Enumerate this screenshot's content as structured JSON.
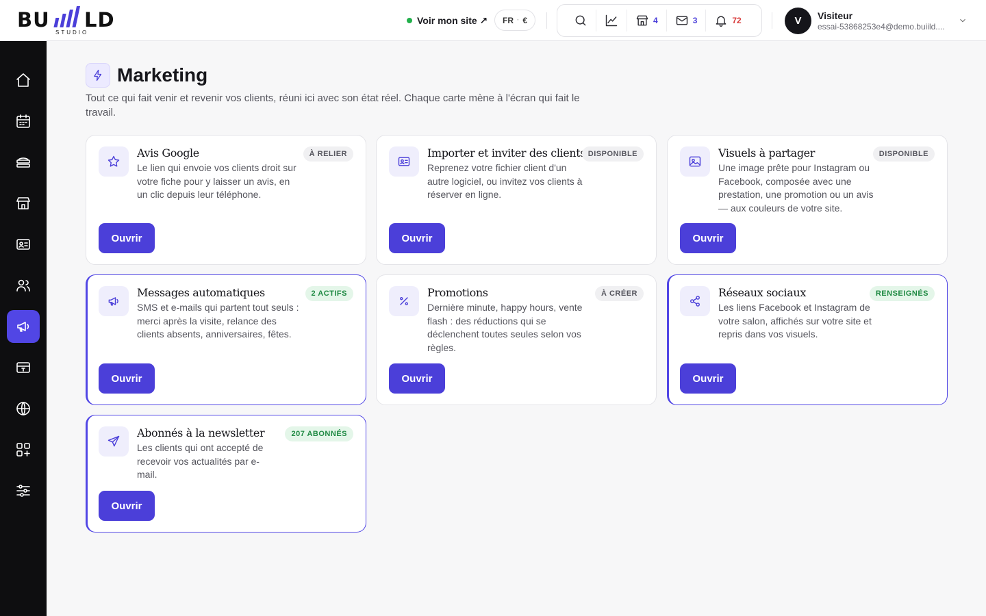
{
  "header": {
    "logo_text": "BU  LD",
    "logo_sub": "STUDIO",
    "site_link": "Voir mon site ↗",
    "lang": "FR",
    "lang_sep": "·",
    "currency": "€",
    "tools": {
      "shop_count": "4",
      "mail_count": "3",
      "notif_count": "72"
    },
    "user": {
      "initial": "V",
      "name": "Visiteur",
      "email": "essai-53868253e4@demo.buiild...."
    }
  },
  "sidebar": {
    "items": [
      {
        "icon": "home-icon"
      },
      {
        "icon": "calendar-icon"
      },
      {
        "icon": "services-icon"
      },
      {
        "icon": "store-icon"
      },
      {
        "icon": "contact-card-icon"
      },
      {
        "icon": "users-icon"
      },
      {
        "icon": "megaphone-icon",
        "active": true
      },
      {
        "icon": "payment-icon"
      },
      {
        "icon": "globe-icon"
      },
      {
        "icon": "apps-icon"
      },
      {
        "icon": "settings-sliders-icon"
      }
    ]
  },
  "page": {
    "title": "Marketing",
    "description": "Tout ce qui fait venir et revenir vos clients, réuni ici avec son état réel. Chaque carte mène à l'écran qui fait le travail."
  },
  "cards": [
    {
      "title": "Avis Google",
      "badge": "À RELIER",
      "description": "Le lien qui envoie vos clients droit sur votre fiche pour y laisser un avis, en un clic depuis leur téléphone.",
      "button": "Ouvrir"
    },
    {
      "title": "Importer et inviter des clients",
      "badge": "DISPONIBLE",
      "description": "Reprenez votre fichier client d'un autre logiciel, ou invitez vos clients à réserver en ligne.",
      "button": "Ouvrir"
    },
    {
      "title": "Visuels à partager",
      "badge": "DISPONIBLE",
      "description": "Une image prête pour Instagram ou Facebook, composée avec une prestation, une promotion ou un avis — aux couleurs de votre site.",
      "button": "Ouvrir"
    },
    {
      "title": "Messages automatiques",
      "badge": "2 ACTIFS",
      "description": "SMS et e-mails qui partent tout seuls : merci après la visite, relance des clients absents, anniversaires, fêtes.",
      "button": "Ouvrir"
    },
    {
      "title": "Promotions",
      "badge": "À CRÉER",
      "description": "Dernière minute, happy hours, vente flash : des réductions qui se déclenchent toutes seules selon vos règles.",
      "button": "Ouvrir"
    },
    {
      "title": "Réseaux sociaux",
      "badge": "RENSEIGNÉS",
      "description": "Les liens Facebook et Instagram de votre salon, affichés sur votre site et repris dans vos visuels.",
      "button": "Ouvrir"
    },
    {
      "title": "Abonnés à la newsletter",
      "badge": "207 ABONNÉS",
      "description": "Les clients qui ont accepté de recevoir vos actualités par e-mail.",
      "button": "Ouvrir"
    }
  ],
  "colors": {
    "accent": "#4b3fd9",
    "sidebar_bg": "#0e0e10",
    "badge_green_bg": "#e4f6e9",
    "badge_green_text": "#1f8a43",
    "notif_red": "#d83a3a",
    "status_dot": "#22b04b"
  }
}
